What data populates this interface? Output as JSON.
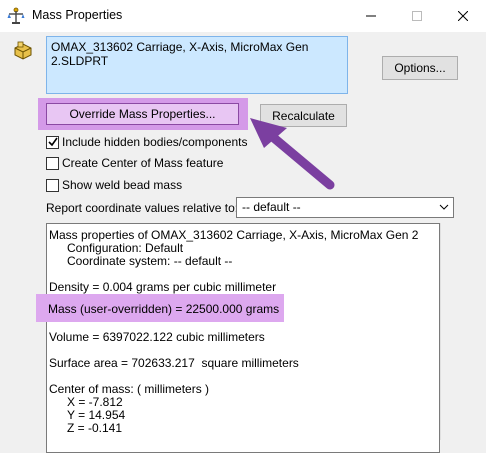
{
  "window": {
    "title": "Mass Properties",
    "minimize_icon": "minimize-icon",
    "maximize_icon": "maximize-icon",
    "close_icon": "close-icon"
  },
  "selection": {
    "items": [
      "OMAX_313602 Carriage, X-Axis, MicroMax Gen 2.SLDPRT"
    ]
  },
  "buttons": {
    "options": "Options...",
    "override": "Override Mass Properties...",
    "recalculate": "Recalculate"
  },
  "checkboxes": [
    {
      "label": "Include hidden bodies/components",
      "checked": true
    },
    {
      "label": "Create Center of Mass feature",
      "checked": false
    },
    {
      "label": "Show weld bead mass",
      "checked": false
    }
  ],
  "coordinates": {
    "label": "Report coordinate values relative to:",
    "selected": "-- default --"
  },
  "results": {
    "header": "Mass properties of OMAX_313602 Carriage, X-Axis, MicroMax Gen 2",
    "configuration": "Configuration: Default",
    "coordinate_system": "Coordinate system: -- default --",
    "density": "Density = 0.004 grams per cubic millimeter",
    "mass": "Mass (user-overridden) = 22500.000 grams",
    "volume": "Volume = 6397022.122 cubic millimeters",
    "surface_area": "Surface area = 702633.217  square millimeters",
    "com_header": "Center of mass: ( millimeters )",
    "com_x": "X = -7.812",
    "com_y": "Y = 14.954",
    "com_z": "Z = -0.141"
  },
  "colors": {
    "highlight": "#d49ae8",
    "arrow": "#7b3fa0",
    "selection_bg": "#cce8ff"
  }
}
